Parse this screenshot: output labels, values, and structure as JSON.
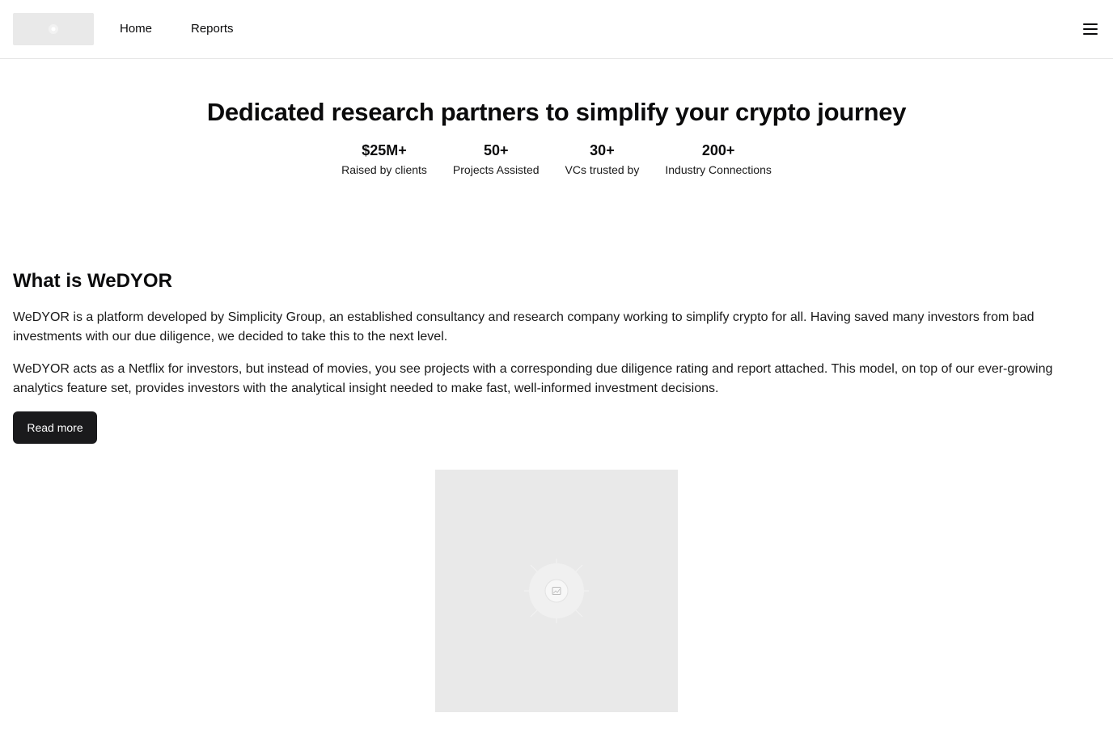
{
  "header": {
    "logo_icon": "logo-placeholder-icon",
    "nav": [
      {
        "label": "Home"
      },
      {
        "label": "Reports"
      }
    ],
    "menu_icon": "hamburger-menu-icon"
  },
  "hero": {
    "title": "Dedicated research partners to simplify your crypto journey",
    "stats": [
      {
        "value": "$25M+",
        "label": "Raised by clients"
      },
      {
        "value": "50+",
        "label": "Projects Assisted"
      },
      {
        "value": "30+",
        "label": "VCs trusted by"
      },
      {
        "value": "200+",
        "label": "Industry Connections"
      }
    ]
  },
  "about": {
    "title": "What is WeDYOR",
    "paragraphs": [
      "WeDYOR is a platform developed by Simplicity Group, an established consultancy and research company working to simplify crypto for all. Having saved many investors from bad investments with our due diligence, we decided to take this to the next level.",
      "WeDYOR acts as a Netflix for investors, but instead of movies, you see projects with a corresponding due diligence rating and report attached. This model, on top of our ever-growing analytics feature set, provides investors with the analytical insight needed to make fast, well-informed investment decisions."
    ],
    "read_more_label": "Read more",
    "image_icon": "image-placeholder-icon"
  },
  "colors": {
    "text": "#0b0b0c",
    "button_bg": "#1a1a1c",
    "placeholder_bg": "#e9e9e9",
    "divider": "#e6e6e6"
  }
}
